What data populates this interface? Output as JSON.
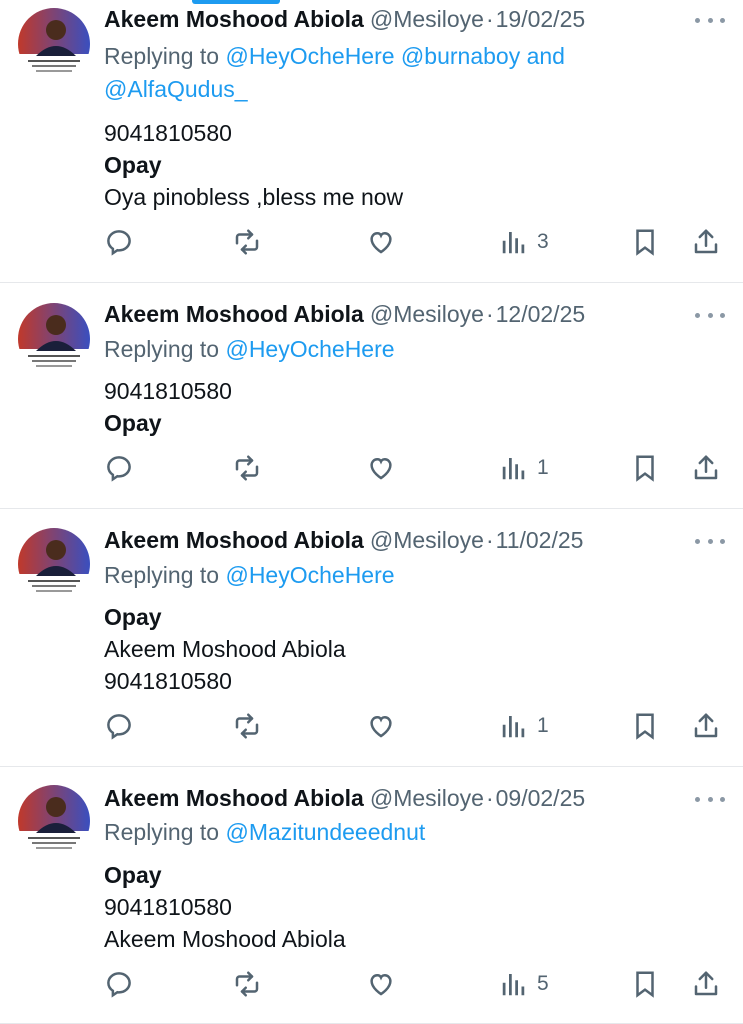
{
  "tweets": [
    {
      "name": "Akeem Moshood Abiola",
      "handle": "@Mesiloye",
      "sep": "·",
      "date": "19/02/25",
      "replying_prefix": "Replying to",
      "replying_line1": "@HeyOcheHere @burnaboy and",
      "replying_line2": "@AlfaQudus_",
      "lines": [
        "9041810580",
        "Opay",
        "Oya pinobless ,bless me now"
      ],
      "views": "3"
    },
    {
      "name": "Akeem Moshood Abiola",
      "handle": "@Mesiloye",
      "sep": "·",
      "date": "12/02/25",
      "replying_prefix": "Replying to",
      "replying_line1": "@HeyOcheHere",
      "lines": [
        "9041810580",
        "Opay"
      ],
      "views": "1"
    },
    {
      "name": "Akeem Moshood Abiola",
      "handle": "@Mesiloye",
      "sep": "·",
      "date": "11/02/25",
      "replying_prefix": "Replying to",
      "replying_line1": "@HeyOcheHere",
      "lines": [
        "Opay",
        "Akeem Moshood Abiola",
        "9041810580"
      ],
      "views": "1"
    },
    {
      "name": "Akeem Moshood Abiola",
      "handle": "@Mesiloye",
      "sep": "·",
      "date": "09/02/25",
      "replying_prefix": "Replying to",
      "replying_line1": "@Mazitundeeednut",
      "lines": [
        "Opay",
        "9041810580",
        "Akeem Moshood Abiola"
      ],
      "views": "5"
    }
  ],
  "icons": {
    "reply": "reply-icon",
    "retweet": "retweet-icon",
    "like": "like-icon",
    "views": "views-icon",
    "bookmark": "bookmark-icon",
    "share": "share-icon",
    "more": "more-icon"
  },
  "colors": {
    "accent": "#1d9bf0",
    "text": "#0f1419",
    "muted": "#536471",
    "divider": "#e6e8eb"
  }
}
